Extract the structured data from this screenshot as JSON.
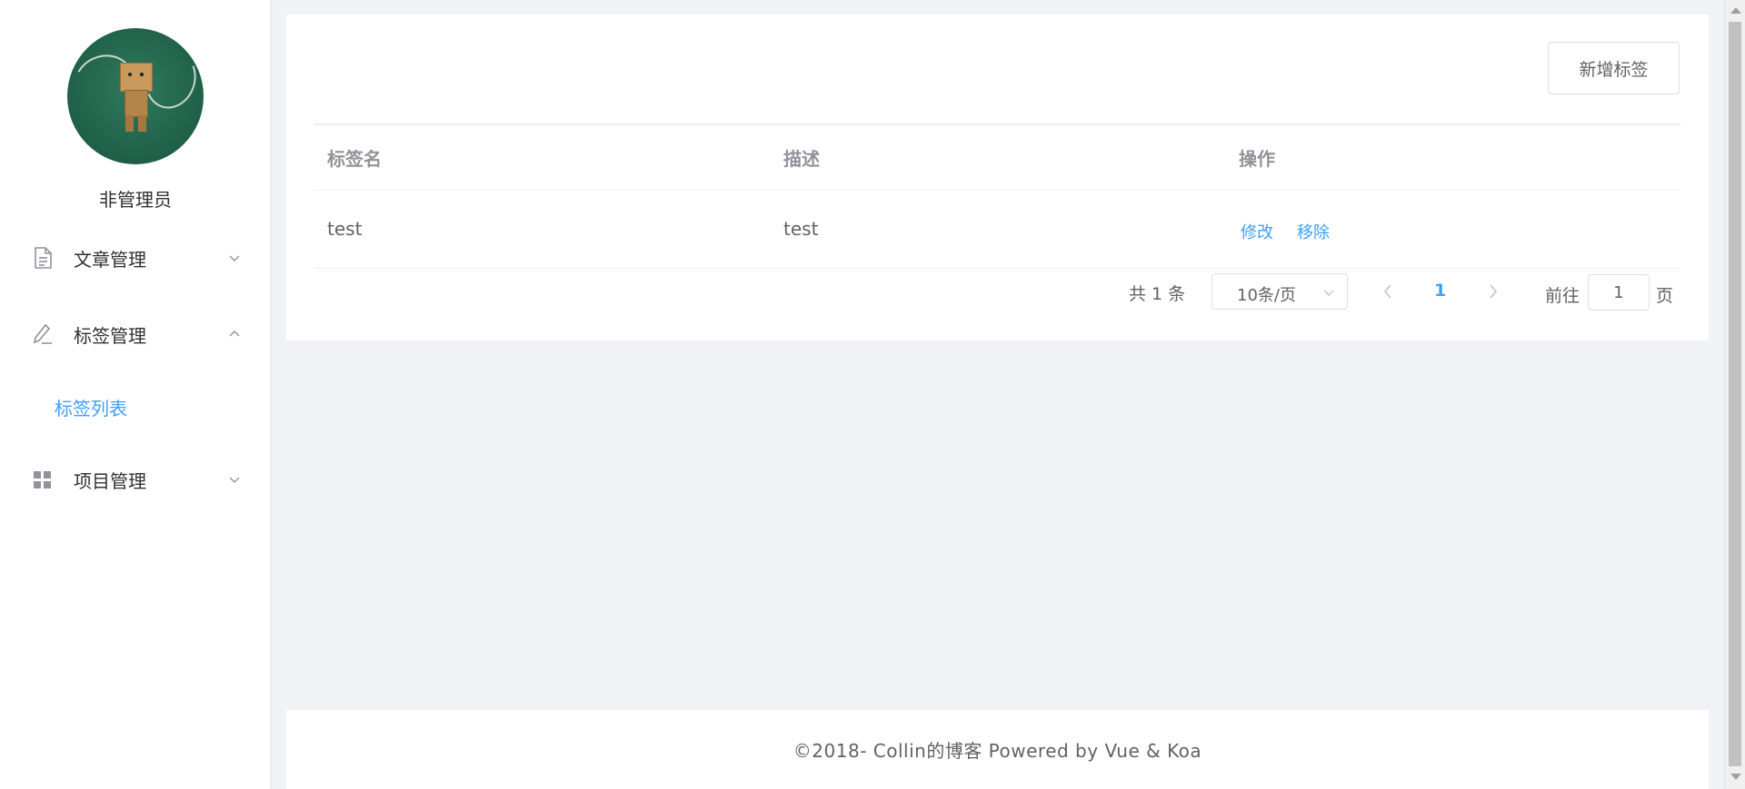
{
  "sidebar": {
    "username": "非管理员",
    "menu": [
      {
        "label": "文章管理",
        "icon": "document-icon",
        "expanded": false
      },
      {
        "label": "标签管理",
        "icon": "edit-icon",
        "expanded": true
      },
      {
        "label": "项目管理",
        "icon": "grid-icon",
        "expanded": false
      }
    ],
    "submenu": {
      "label": "标签列表",
      "active": true
    }
  },
  "toolbar": {
    "add_label": "新增标签"
  },
  "table": {
    "columns": [
      "标签名",
      "描述",
      "操作"
    ],
    "rows": [
      {
        "name": "test",
        "description": "test",
        "actions": [
          "修改",
          "移除"
        ]
      }
    ]
  },
  "pagination": {
    "total": "共 1 条",
    "page_size": "10条/页",
    "current_page": "1",
    "goto_label": "前往",
    "goto_value": "1",
    "goto_suffix": "页"
  },
  "footer": {
    "text": "©2018- Collin的博客 Powered by Vue & Koa"
  },
  "colors": {
    "accent": "#409eff",
    "background": "#f0f2f5",
    "text": "#606266",
    "header_text": "#909399"
  }
}
